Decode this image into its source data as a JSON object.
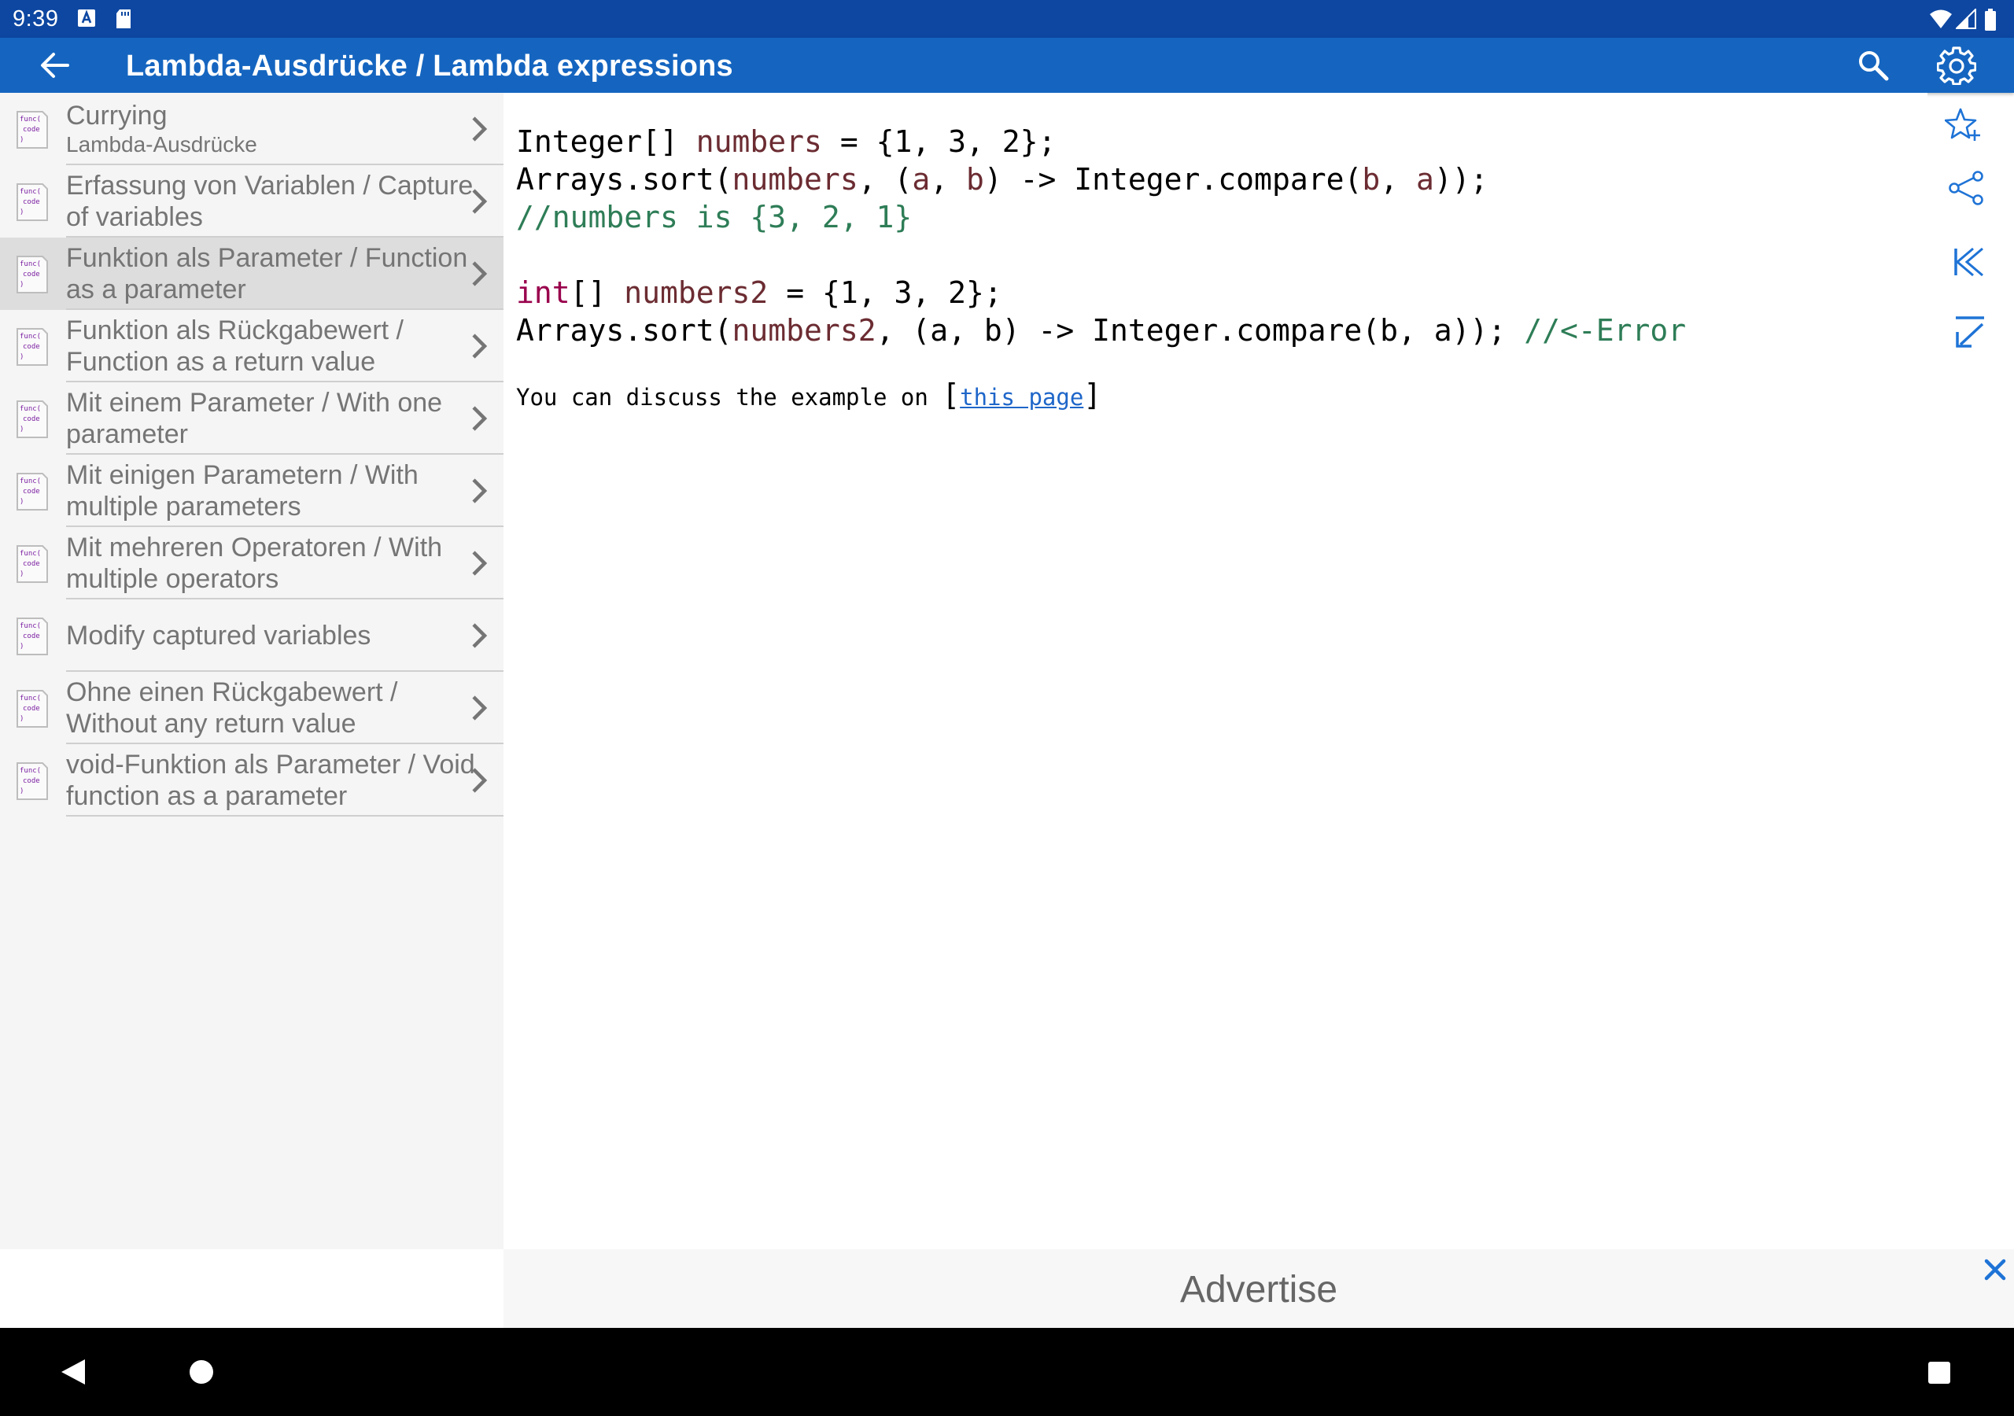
{
  "status_bar": {
    "time": "9:39"
  },
  "app_bar": {
    "title": "Lambda-Ausdrücke / Lambda expressions"
  },
  "sidebar": {
    "items": [
      {
        "label": "Currying",
        "sublabel": "Lambda-Ausdrücke",
        "selected": false
      },
      {
        "label": "Erfassung von Variablen / Capture of variables",
        "selected": false
      },
      {
        "label": "Funktion als Parameter / Function as a parameter",
        "selected": true
      },
      {
        "label": "Funktion als Rückgabewert / Function as a return value",
        "selected": false
      },
      {
        "label": "Mit einem Parameter / With one parameter",
        "selected": false
      },
      {
        "label": "Mit einigen Parametern / With multiple parameters",
        "selected": false
      },
      {
        "label": "Mit mehreren Operatoren / With multiple operators",
        "selected": false
      },
      {
        "label": "Modify captured variables",
        "selected": false
      },
      {
        "label": "Ohne einen Rückgabewert / Without any return value",
        "selected": false
      },
      {
        "label": "void-Funktion als Parameter / Void function as a parameter",
        "selected": false
      }
    ],
    "icon_text": "func( code )"
  },
  "code": {
    "l1_type": "Integer[] ",
    "l1_var": "numbers",
    "l1_rest": " = {1, 3, 2};",
    "l2_a": "Arrays.sort(",
    "l2_var1": "numbers",
    "l2_b": ", (",
    "l2_var2": "a",
    "l2_c": ", ",
    "l2_var3": "b",
    "l2_d": ") -> Integer.compare(",
    "l2_var4": "b",
    "l2_e": ", ",
    "l2_var5": "a",
    "l2_f": "));",
    "l3_comment": "//numbers is {3, 2, 1}",
    "l5_kw": "int",
    "l5_b": "[] ",
    "l5_var": "numbers2",
    "l5_rest": " = {1, 3, 2};",
    "l6_a": "Arrays.sort(",
    "l6_var": "numbers2",
    "l6_rest": ", (a, b) -> Integer.compare(b, a)); ",
    "l6_comment": "//<-Error"
  },
  "discuss": {
    "prefix": "You can discuss the example on ",
    "link_text": "this page"
  },
  "ad": {
    "text": "Advertise"
  },
  "colors": {
    "status_bar": "#0d47a1",
    "app_bar": "#1565c0",
    "rail_icon": "#1e73d6",
    "code_variable": "#6b2c32",
    "code_comment": "#2e7d57",
    "code_keyword": "#99004c",
    "link": "#1e66c9"
  },
  "icons": {
    "back": "arrow-back-icon",
    "search": "search-icon",
    "settings": "gear-icon",
    "favorite": "star-add-icon",
    "share": "share-icon",
    "first": "skip-first-icon",
    "scroll_down": "arrow-down-left-icon",
    "close_ad": "close-icon"
  }
}
